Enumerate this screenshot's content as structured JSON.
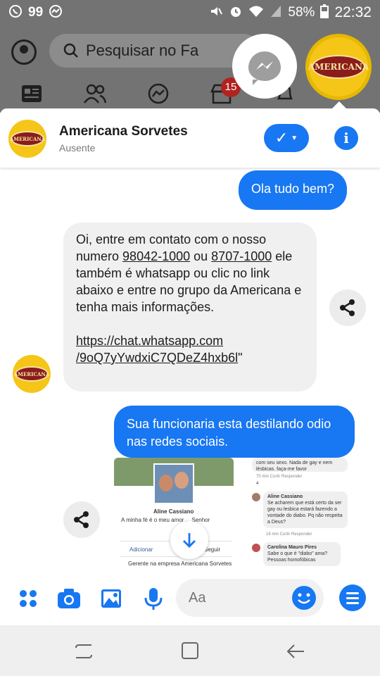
{
  "status_bar": {
    "left_icons": [
      "whatsapp-icon",
      "notification-count",
      "messenger-icon"
    ],
    "notification_count": "99",
    "battery": "58%",
    "time": "22:32"
  },
  "facebook": {
    "search_placeholder": "Pesquisar no Fa",
    "badge_count": "15"
  },
  "chat": {
    "contact_name": "Americana Sorvetes",
    "contact_status": "Ausente",
    "brand_text": "AMERICANA",
    "messages": [
      {
        "direction": "out",
        "text": "Ola tudo bem?"
      },
      {
        "direction": "in",
        "parts": {
          "a": "Oi, entre em contato com o nosso numero ",
          "phone1": "98042-1000",
          "b": " ou ",
          "phone2": "8707-1000",
          "c": " ele também é whatsapp ou clic no link abaixo e entre no grupo da Americana e tenha mais informações.",
          "link1": "https://chat.whatsapp.com",
          "link2": "/9oQ7yYwdxiC7QDeZ4hxb6l",
          "d": "\""
        }
      },
      {
        "direction": "out",
        "text": "Sua funcionaria esta destilando odio nas redes sociais."
      }
    ],
    "screenshot_attachment": {
      "profile_name": "Aline Cassiano",
      "bio": "A minha fé é o meu amor ... Senhor",
      "add_button": "Adicionar",
      "follow": "Seguir",
      "work": "Gerente na empresa Americana Sorvetes",
      "comment_top": "com seu sexo. Nada de gay e nem lésbicas. faça-me favor",
      "comment_meta_1": "70 min   Curtir   Responder",
      "reaction_count": "4",
      "commenter_1": "Aline Cassiano",
      "comment_1": "Se acharem que está certo da ser gay ou lesbica estará fazendo a vontade do diabo. Pq não respeita a Deus?",
      "comment_meta_2": "16 min   Curtir   Responder",
      "commenter_2": "Carolina Mauro Pires",
      "comment_2": "Sabe o que é \"diabo\" ama? Pessoas homofóbicas"
    },
    "composer_placeholder": "Aa"
  },
  "colors": {
    "messenger_blue": "#1877f2",
    "incoming_bubble": "#f0f0f0",
    "overlay_gray": "#737373",
    "brand_yellow": "#f5c518",
    "brand_red": "#8a1c1c"
  }
}
